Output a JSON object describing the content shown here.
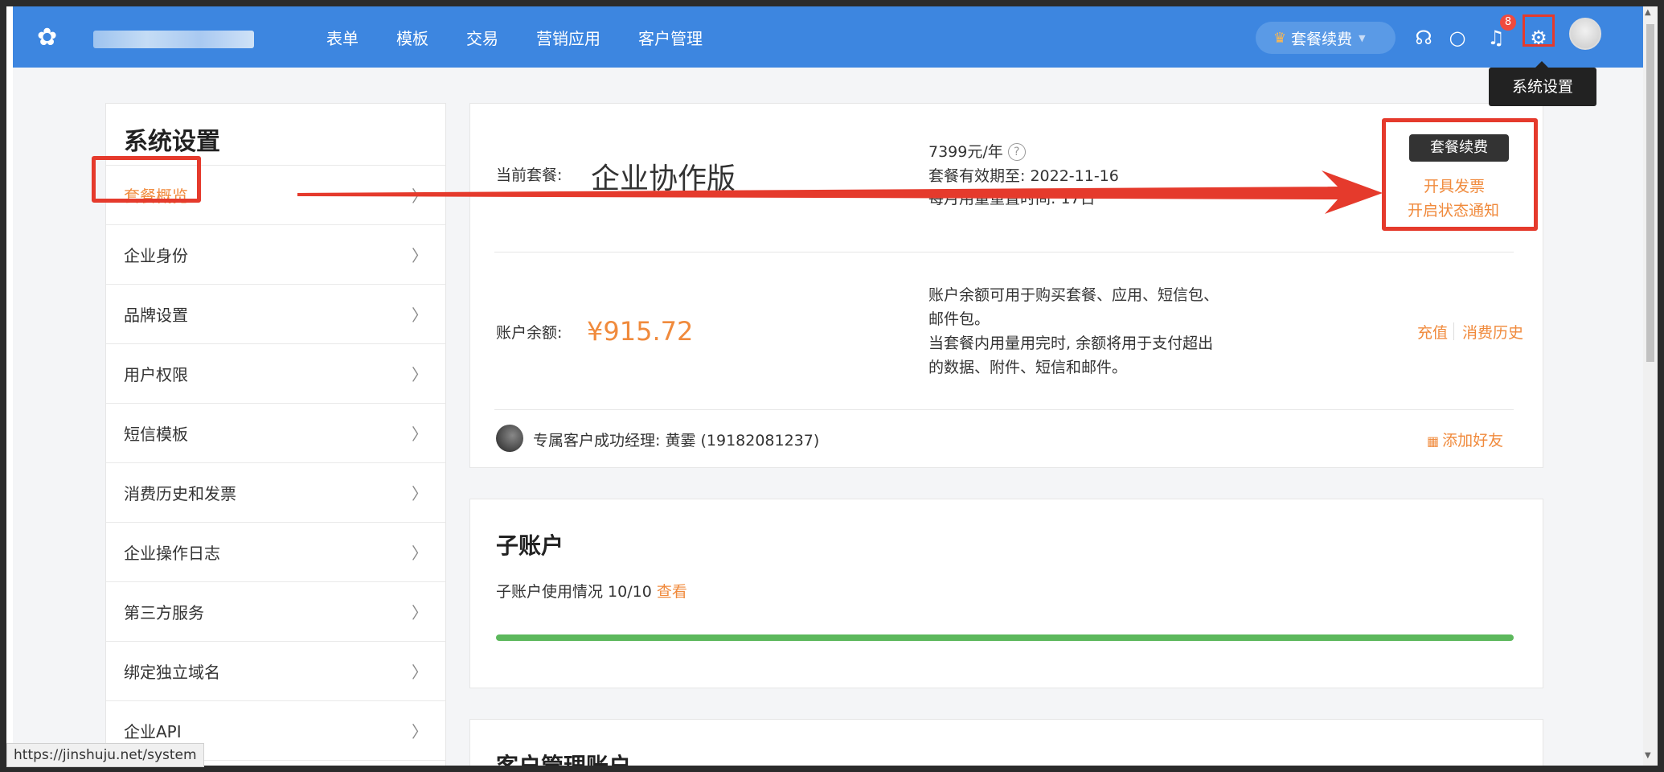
{
  "nav": {
    "items": [
      "表单",
      "模板",
      "交易",
      "营销应用",
      "客户管理"
    ],
    "plan_pill": "套餐续费",
    "badge": "8",
    "tooltip": "系统设置",
    "icons": [
      "headset-icon",
      "search-icon",
      "bell-icon",
      "gear-icon"
    ]
  },
  "sidebar": {
    "title": "系统设置",
    "items": [
      {
        "label": "套餐概览"
      },
      {
        "label": "企业身份"
      },
      {
        "label": "品牌设置"
      },
      {
        "label": "用户权限"
      },
      {
        "label": "短信模板"
      },
      {
        "label": "消费历史和发票"
      },
      {
        "label": "企业操作日志"
      },
      {
        "label": "第三方服务"
      },
      {
        "label": "绑定独立域名"
      },
      {
        "label": "企业API"
      }
    ]
  },
  "plan": {
    "label": "当前套餐:",
    "name": "企业协作版",
    "price": "7399元/年",
    "valid_until": "套餐有效期至: 2022-11-16",
    "reset": "每月用量重置时间: 17日",
    "renew_button": "套餐续费",
    "invoice_link": "开具发票",
    "notify_link": "开启状态通知"
  },
  "balance": {
    "label": "账户余额:",
    "amount": "¥915.72",
    "desc1": "账户余额可用于购买套餐、应用、短信包、",
    "desc2": "邮件包。",
    "desc3": "当套餐内用量用完时, 余额将用于支付超出",
    "desc4": "的数据、附件、短信和邮件。",
    "recharge": "充值",
    "history": "消费历史"
  },
  "manager": {
    "text": "专属客户成功经理: 黄霎 (19182081237)",
    "add_friend": "添加好友"
  },
  "subaccount": {
    "title": "子账户",
    "usage": "子账户使用情况 10/10",
    "view": "查看",
    "progress": 1.0
  },
  "customer": {
    "title": "客户管理账户"
  },
  "status_url": "https://jinshuju.net/system",
  "colors": {
    "nav_bg": "#3d86e0",
    "accent": "#f08a3c",
    "highlight": "#e53a2c",
    "progress": "#5cb85c"
  }
}
